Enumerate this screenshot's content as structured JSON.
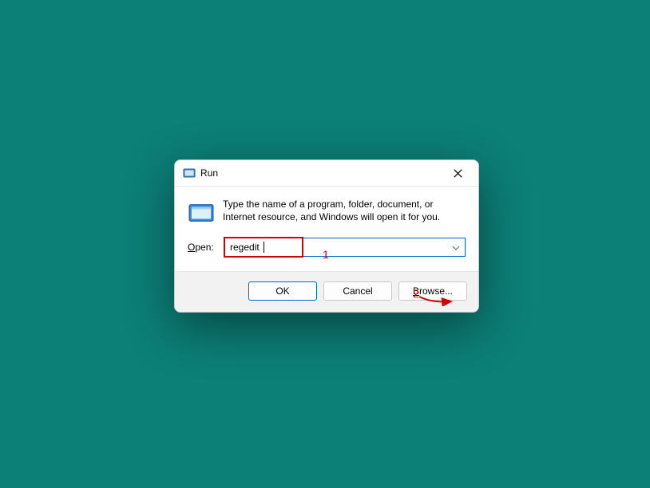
{
  "dialog": {
    "title": "Run",
    "description": "Type the name of a program, folder, document, or Internet resource, and Windows will open it for you.",
    "open_label_pre": "O",
    "open_label_post": "pen:",
    "input_value": "regedit",
    "input_placeholder": "",
    "buttons": {
      "ok": "OK",
      "cancel": "Cancel",
      "browse_pre": "B",
      "browse_post": "rowse..."
    }
  },
  "annotations": {
    "label1": "1",
    "label2": "2"
  }
}
